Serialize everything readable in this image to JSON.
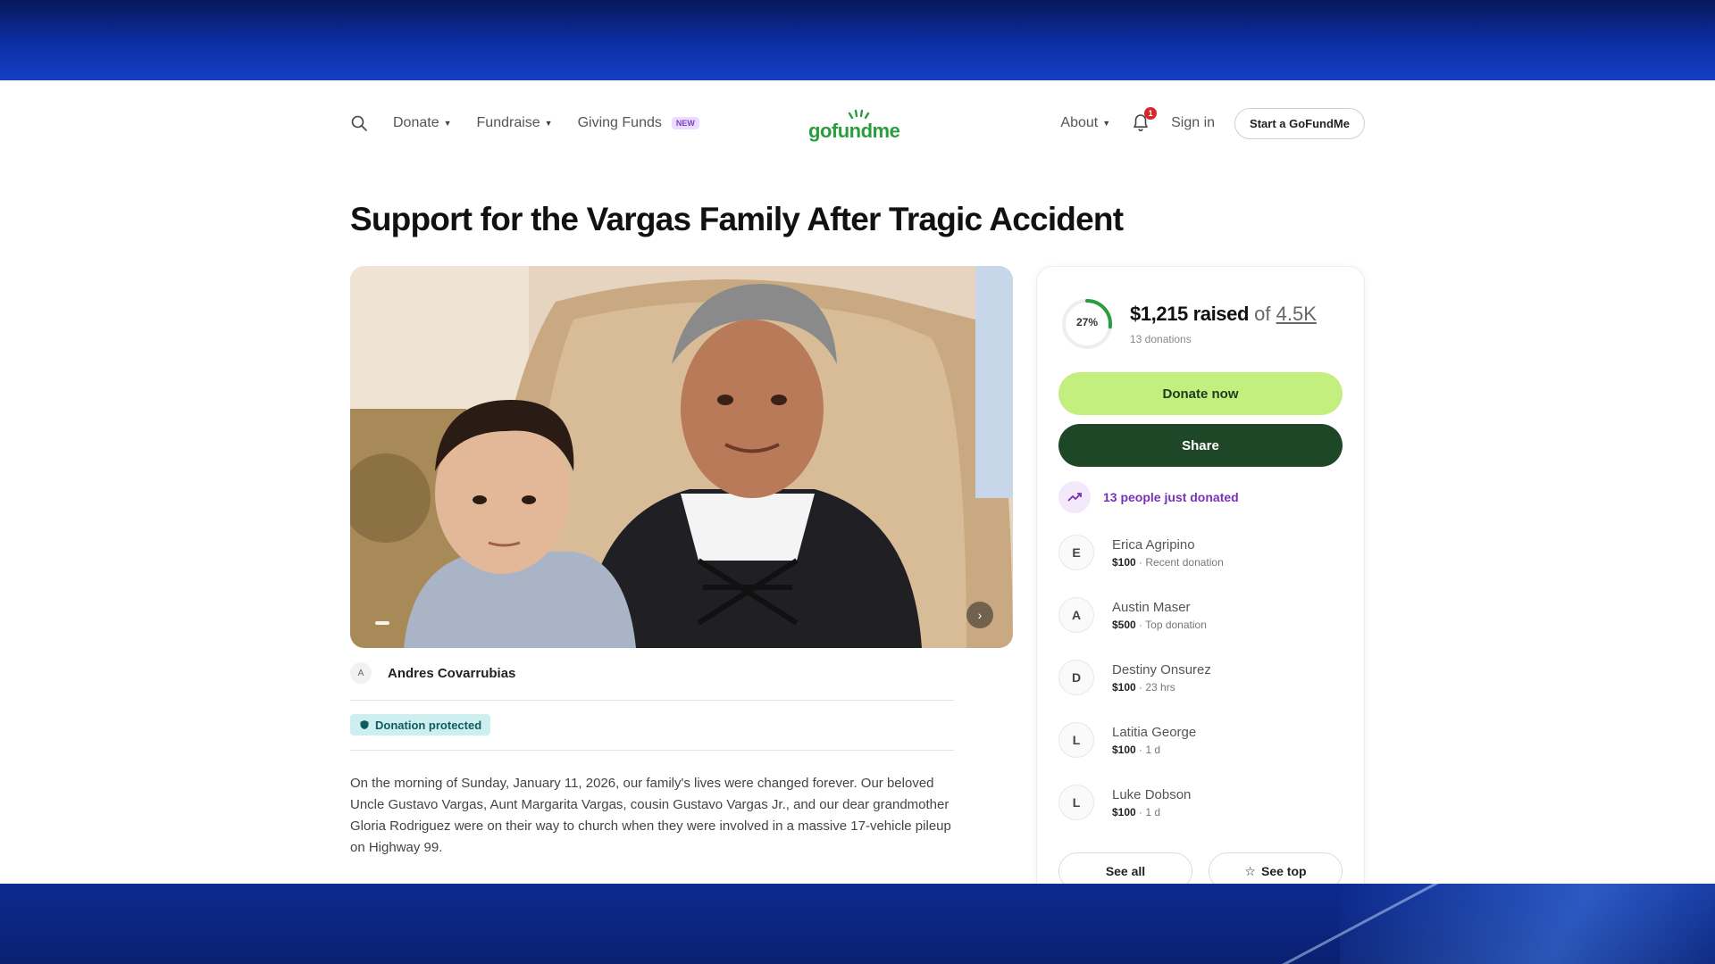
{
  "header": {
    "nav_left": [
      {
        "label": "Donate",
        "has_caret": true
      },
      {
        "label": "Fundraise",
        "has_caret": true
      },
      {
        "label": "Giving Funds",
        "badge": "NEW"
      }
    ],
    "logo": "gofundme",
    "about": "About",
    "notification_count": "1",
    "sign_in": "Sign in",
    "start_button": "Start a GoFundMe"
  },
  "campaign": {
    "title": "Support for the Vargas Family After Tragic Accident",
    "organizer_initial": "A",
    "organizer": "Andres Covarrubias",
    "protected_label": "Donation protected",
    "story": "On the morning of Sunday, January 11, 2026, our family's lives were changed forever. Our beloved Uncle Gustavo Vargas, Aunt Margarita Vargas, cousin Gustavo Vargas Jr., and our dear grandmother Gloria Rodriguez were on their way to church when they were involved in a massive 17-vehicle pileup on Highway 99."
  },
  "card": {
    "progress_percent": 27,
    "progress_label": "27%",
    "raised": "$1,215 raised",
    "of": "of",
    "goal": "4.5K",
    "donations_count": "13 donations",
    "donate_button": "Donate now",
    "share_button": "Share",
    "trend_text": "13 people just donated",
    "donors": [
      {
        "initial": "E",
        "name": "Erica Agripino",
        "amount": "$100",
        "note": " · Recent donation"
      },
      {
        "initial": "A",
        "name": "Austin Maser",
        "amount": "$500",
        "note": " · Top donation"
      },
      {
        "initial": "D",
        "name": "Destiny Onsurez",
        "amount": "$100",
        "note": " · 23 hrs"
      },
      {
        "initial": "L",
        "name": "Latitia George",
        "amount": "$100",
        "note": " · 1 d"
      },
      {
        "initial": "L",
        "name": "Luke Dobson",
        "amount": "$100",
        "note": " · 1 d"
      }
    ],
    "see_all": "See all",
    "see_top": "See top"
  },
  "colors": {
    "brand_green": "#2a9d3e",
    "donate_green": "#c3ef7e",
    "share_green": "#1d4727",
    "trend_purple": "#7a30b8",
    "tv_frame_blue": "#0d2fa6"
  }
}
